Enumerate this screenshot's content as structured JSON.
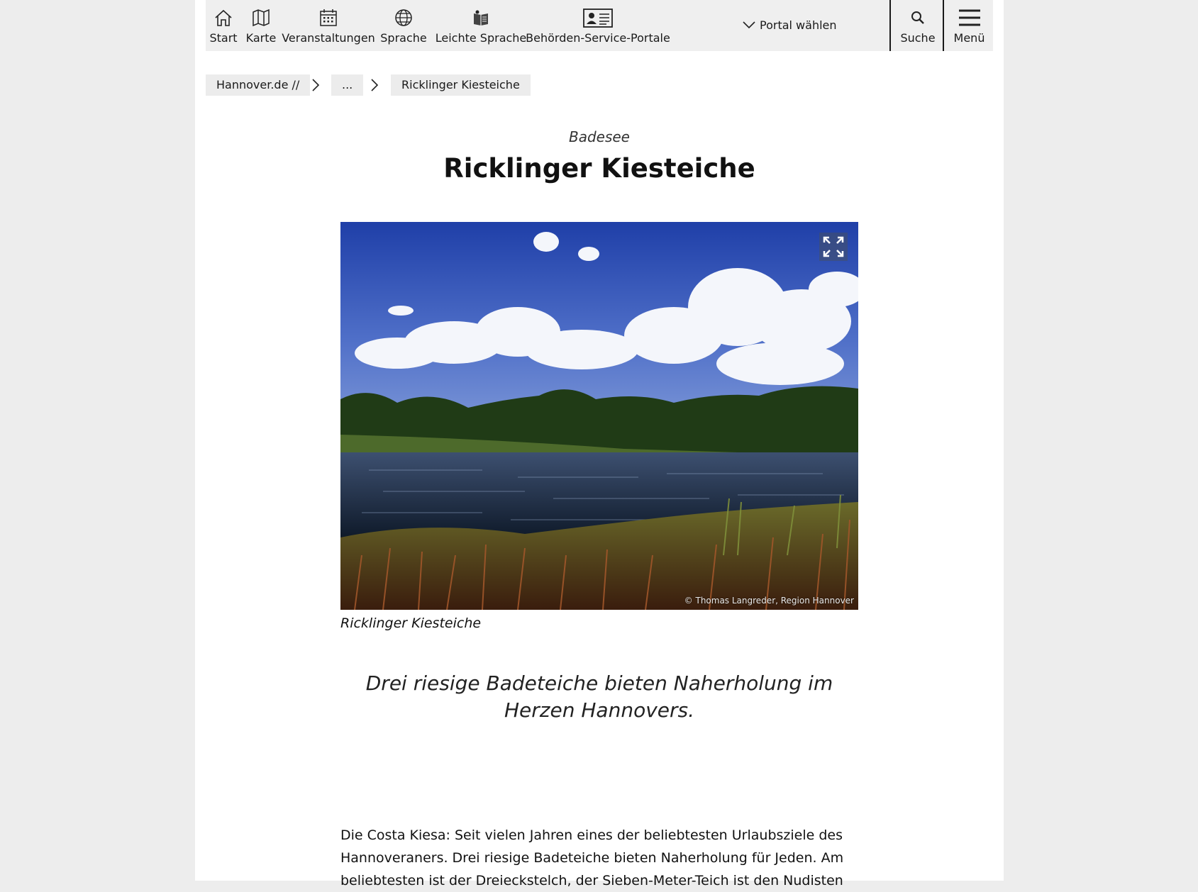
{
  "nav": {
    "items": [
      {
        "label": "Start",
        "icon": "home-icon"
      },
      {
        "label": "Karte",
        "icon": "map-icon"
      },
      {
        "label": "Veranstaltungen",
        "icon": "calendar-icon"
      },
      {
        "label": "Sprache",
        "icon": "globe-icon"
      },
      {
        "label": "Leichte Sprache",
        "icon": "easy-language-icon"
      },
      {
        "label": "Behörden-Service-Portale",
        "icon": "id-card-icon"
      }
    ],
    "portal_label": "Portal wählen",
    "search_label": "Suche",
    "menu_label": "Menü"
  },
  "breadcrumb": {
    "items": [
      "Hannover.de //",
      "...",
      "Ricklinger Kiesteiche"
    ]
  },
  "article": {
    "kicker": "Badesee",
    "title": "Ricklinger Kiesteiche",
    "image_credit": "© Thomas Langreder, Region Hannover",
    "caption": "Ricklinger Kiesteiche",
    "lead": "Drei riesige Badeteiche bieten Naherholung im Herzen Hannovers.",
    "body": "Die Costa Kiesa: Seit vielen Jahren eines der beliebtesten Urlaubsziele des Hannoveraners. Drei riesige Badeteiche bieten Naherholung für Jeden. Am beliebtesten ist der Dreieckstelch, der Sieben-Meter-Teich ist den Nudisten"
  }
}
